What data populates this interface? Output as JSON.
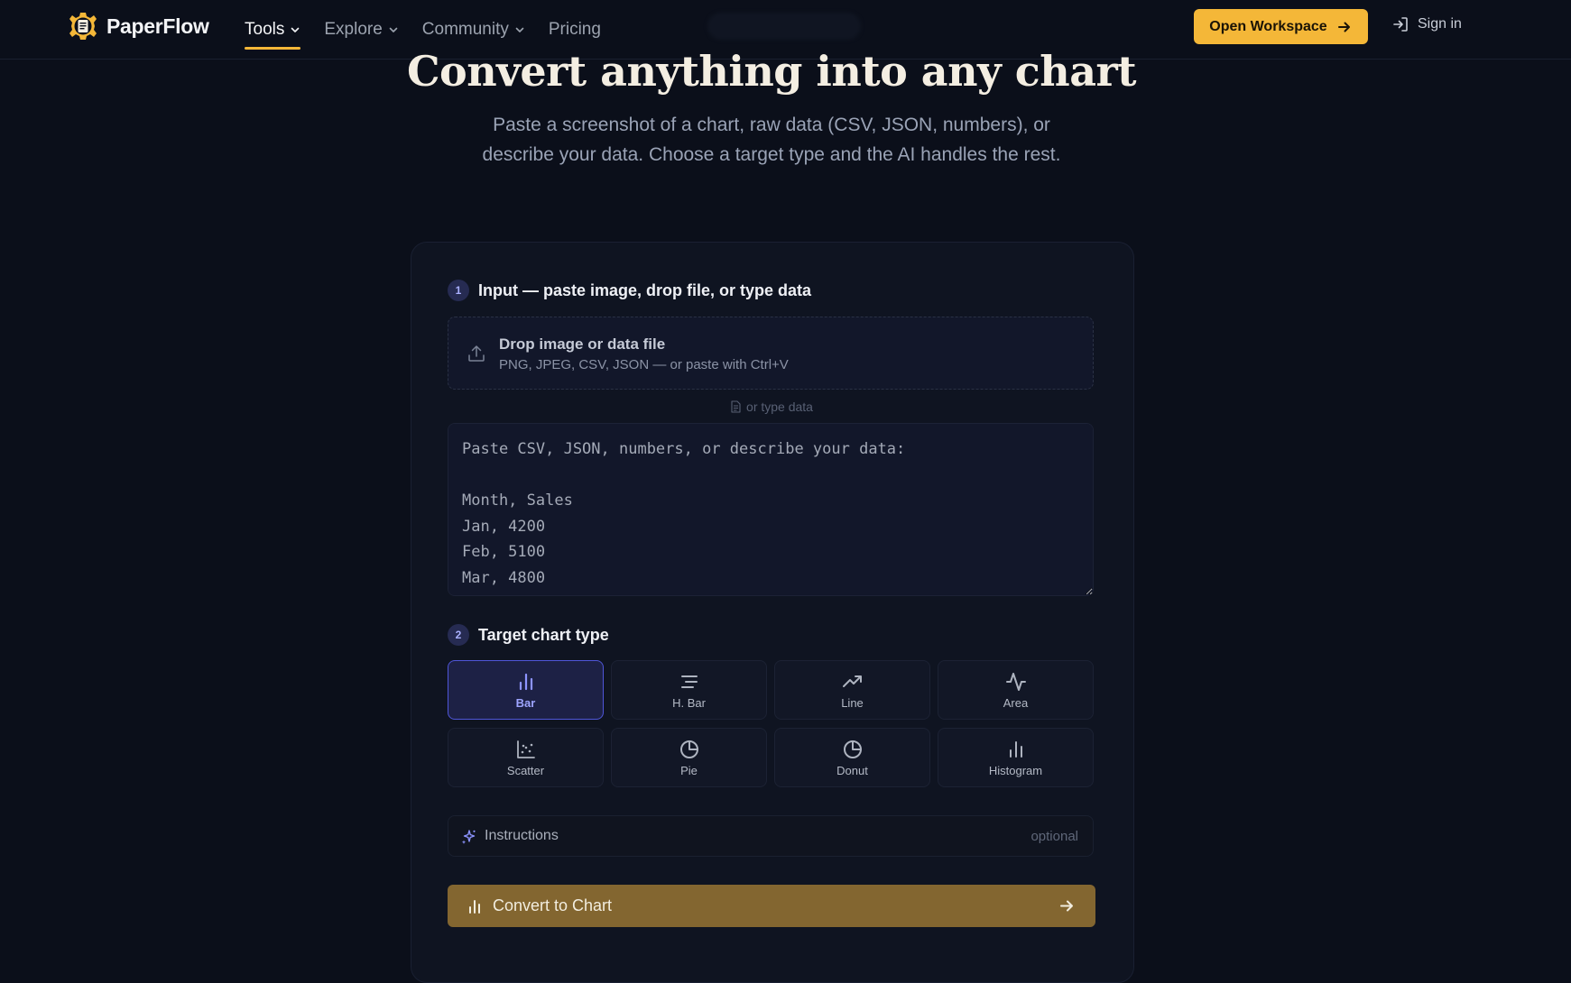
{
  "brand": {
    "name": "PaperFlow",
    "logo_icon": "gear-document-icon",
    "accent": "#f4b738"
  },
  "nav": {
    "items": [
      {
        "label": "Tools",
        "active": true,
        "has_dropdown": true
      },
      {
        "label": "Explore",
        "active": false,
        "has_dropdown": true
      },
      {
        "label": "Community",
        "active": false,
        "has_dropdown": true
      },
      {
        "label": "Pricing",
        "active": false,
        "has_dropdown": false
      }
    ]
  },
  "header": {
    "open_workspace_label": "Open Workspace",
    "signin_label": "Sign in"
  },
  "hero": {
    "title": "Convert anything into any chart",
    "subtitle": "Paste a screenshot of a chart, raw data (CSV, JSON, numbers), or describe your data. Choose a target type and the AI handles the rest."
  },
  "input_section": {
    "step": "1",
    "title": "Input — paste image, drop file, or type data",
    "dropzone": {
      "title": "Drop image or data file",
      "hint": "PNG, JPEG, CSV, JSON — or paste with Ctrl+V",
      "icon": "upload-icon"
    },
    "or_type_label": "or type data",
    "textarea_placeholder": "Paste CSV, JSON, numbers, or describe your data:\n\nMonth, Sales\nJan, 4200\nFeb, 5100\nMar, 4800"
  },
  "chart_type_section": {
    "step": "2",
    "title": "Target chart type",
    "types": [
      {
        "label": "Bar",
        "icon": "bar-chart-icon",
        "selected": true
      },
      {
        "label": "H. Bar",
        "icon": "horizontal-bar-icon",
        "selected": false
      },
      {
        "label": "Line",
        "icon": "trending-up-icon",
        "selected": false
      },
      {
        "label": "Area",
        "icon": "activity-icon",
        "selected": false
      },
      {
        "label": "Scatter",
        "icon": "scatter-icon",
        "selected": false
      },
      {
        "label": "Pie",
        "icon": "pie-chart-icon",
        "selected": false
      },
      {
        "label": "Donut",
        "icon": "donut-chart-icon",
        "selected": false
      },
      {
        "label": "Histogram",
        "icon": "histogram-icon",
        "selected": false
      }
    ]
  },
  "instructions": {
    "label": "Instructions",
    "optional_label": "optional",
    "icon": "sparkles-icon"
  },
  "convert": {
    "label": "Convert to Chart",
    "icon": "bar-chart-icon",
    "button_color": "#836630"
  }
}
